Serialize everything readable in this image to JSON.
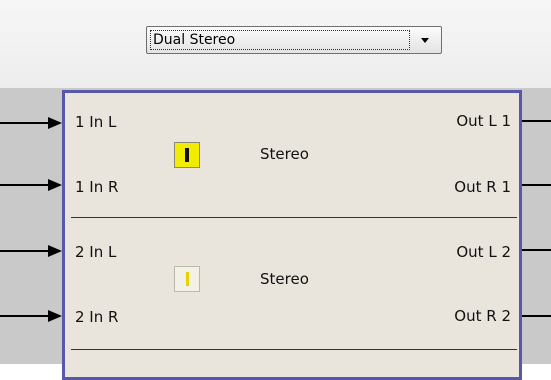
{
  "mode_dropdown": {
    "selected": "Dual Stereo",
    "arrow_icon": "triangle-down-icon"
  },
  "channels": [
    {
      "in_left": "1 In L",
      "in_right": "1 In R",
      "out_left": "Out L 1",
      "out_right": "Out R 1",
      "mode": "Stereo",
      "toggle_label": "I",
      "toggle_state": "on"
    },
    {
      "in_left": "2 In L",
      "in_right": "2 In R",
      "out_left": "Out L 2",
      "out_right": "Out R 2",
      "mode": "Stereo",
      "toggle_label": "I",
      "toggle_state": "off"
    }
  ],
  "colors": {
    "module_border": "#5858a8",
    "module_fill": "#e9e5dc",
    "toggle_on": "#f2ec00",
    "canvas": "#c9c9c9"
  }
}
